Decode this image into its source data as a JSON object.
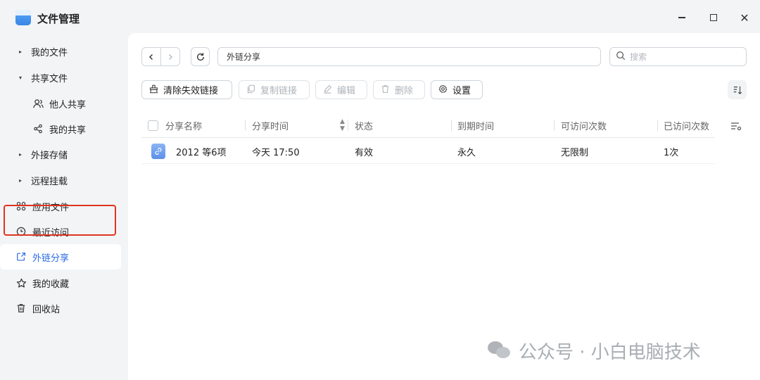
{
  "window": {
    "title": "文件管理"
  },
  "sidebar": {
    "items": [
      {
        "label": "我的文件",
        "caret": "▸"
      },
      {
        "label": "共享文件",
        "caret": "▾"
      },
      {
        "label": "他人共享",
        "icon": "users-icon"
      },
      {
        "label": "我的共享",
        "icon": "share-icon"
      },
      {
        "label": "外接存储",
        "caret": "▸"
      },
      {
        "label": "远程挂载",
        "caret": "▸"
      },
      {
        "label": "应用文件",
        "icon": "apps-icon"
      },
      {
        "label": "最近访问",
        "icon": "clock-icon"
      },
      {
        "label": "外链分享",
        "icon": "link-share-icon"
      },
      {
        "label": "我的收藏",
        "icon": "star-icon"
      },
      {
        "label": "回收站",
        "icon": "trash-icon"
      }
    ],
    "active": "外链分享"
  },
  "header": {
    "path": "外链分享",
    "search_placeholder": "搜索"
  },
  "toolbar": {
    "clean_label": "清除失效链接",
    "copy_label": "复制链接",
    "edit_label": "编辑",
    "delete_label": "删除",
    "settings_label": "设置"
  },
  "table": {
    "columns": [
      "分享名称",
      "分享时间",
      "状态",
      "到期时间",
      "可访问次数",
      "已访问次数"
    ],
    "rows": [
      {
        "name": "2012 等6项",
        "time": "今天 17:50",
        "status": "有效",
        "expiry": "永久",
        "allowed": "无限制",
        "visited": "1次"
      }
    ]
  },
  "watermark": {
    "text": "公众号 · 小白电脑技术"
  }
}
